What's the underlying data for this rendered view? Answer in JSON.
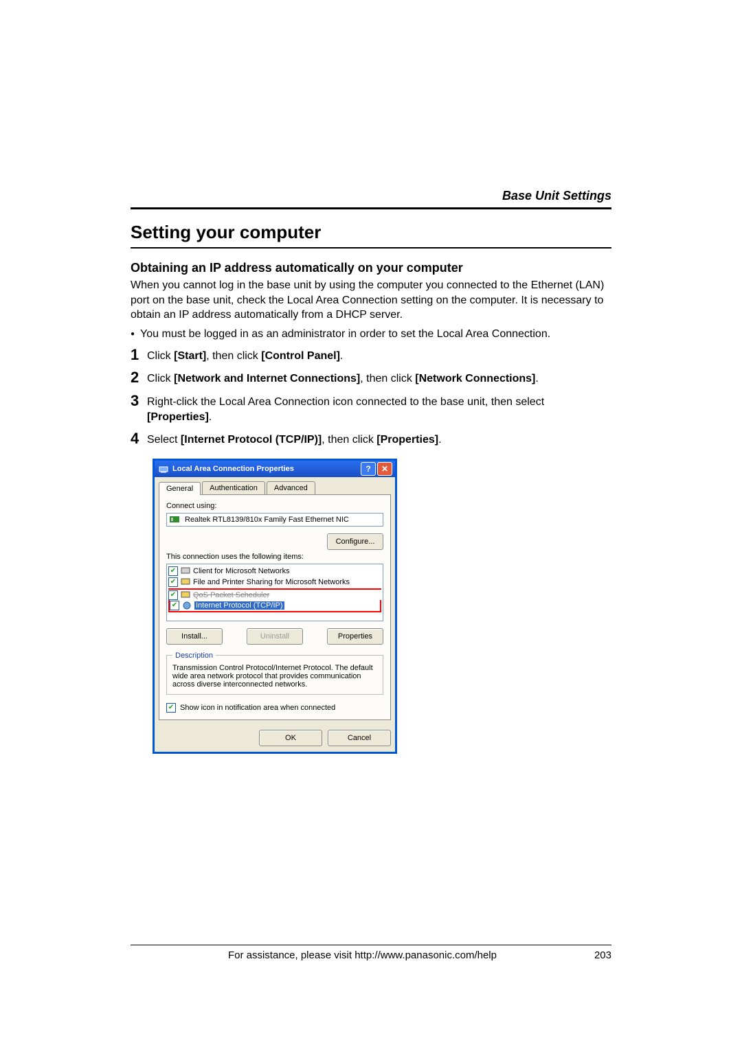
{
  "header": {
    "section": "Base Unit Settings"
  },
  "title": "Setting your computer",
  "subhead": "Obtaining an IP address automatically on your computer",
  "intro": "When you cannot log in the base unit by using the computer you connected to the Ethernet (LAN) port on the base unit, check the Local Area Connection setting on the computer. It is necessary to obtain an IP address automatically from a DHCP server.",
  "bullet1": "You must be logged in as an administrator in order to set the Local Area Connection.",
  "steps": [
    {
      "pre": "Click ",
      "b1": "[Start]",
      "mid": ", then click ",
      "b2": "[Control Panel]",
      "post": "."
    },
    {
      "pre": "Click ",
      "b1": "[Network and Internet Connections]",
      "mid": ", then click ",
      "b2": "[Network Connections]",
      "post": "."
    },
    {
      "pre": "Right-click the Local Area Connection icon connected to the base unit, then select ",
      "b1": "[Properties]",
      "mid": "",
      "b2": "",
      "post": "."
    },
    {
      "pre": "Select ",
      "b1": "[Internet Protocol (TCP/IP)]",
      "mid": ", then click ",
      "b2": "[Properties]",
      "post": "."
    }
  ],
  "dialog": {
    "title": "Local Area Connection Properties",
    "tabs": {
      "t1": "General",
      "t2": "Authentication",
      "t3": "Advanced"
    },
    "connect_using_label": "Connect using:",
    "nic_text": "Realtek RTL8139/810x Family Fast Ethernet NIC",
    "configure_btn": "Configure...",
    "items_label": "This connection uses the following items:",
    "items": [
      "Client for Microsoft Networks",
      "File and Printer Sharing for Microsoft Networks",
      "QoS Packet Scheduler",
      "Internet Protocol (TCP/IP)"
    ],
    "install_btn": "Install...",
    "uninstall_btn": "Uninstall",
    "properties_btn": "Properties",
    "desc_legend": "Description",
    "desc_text": "Transmission Control Protocol/Internet Protocol. The default wide area network protocol that provides communication across diverse interconnected networks.",
    "show_icon_label": "Show icon in notification area when connected",
    "ok_btn": "OK",
    "cancel_btn": "Cancel"
  },
  "footer": {
    "assist": "For assistance, please visit http://www.panasonic.com/help",
    "page": "203"
  }
}
